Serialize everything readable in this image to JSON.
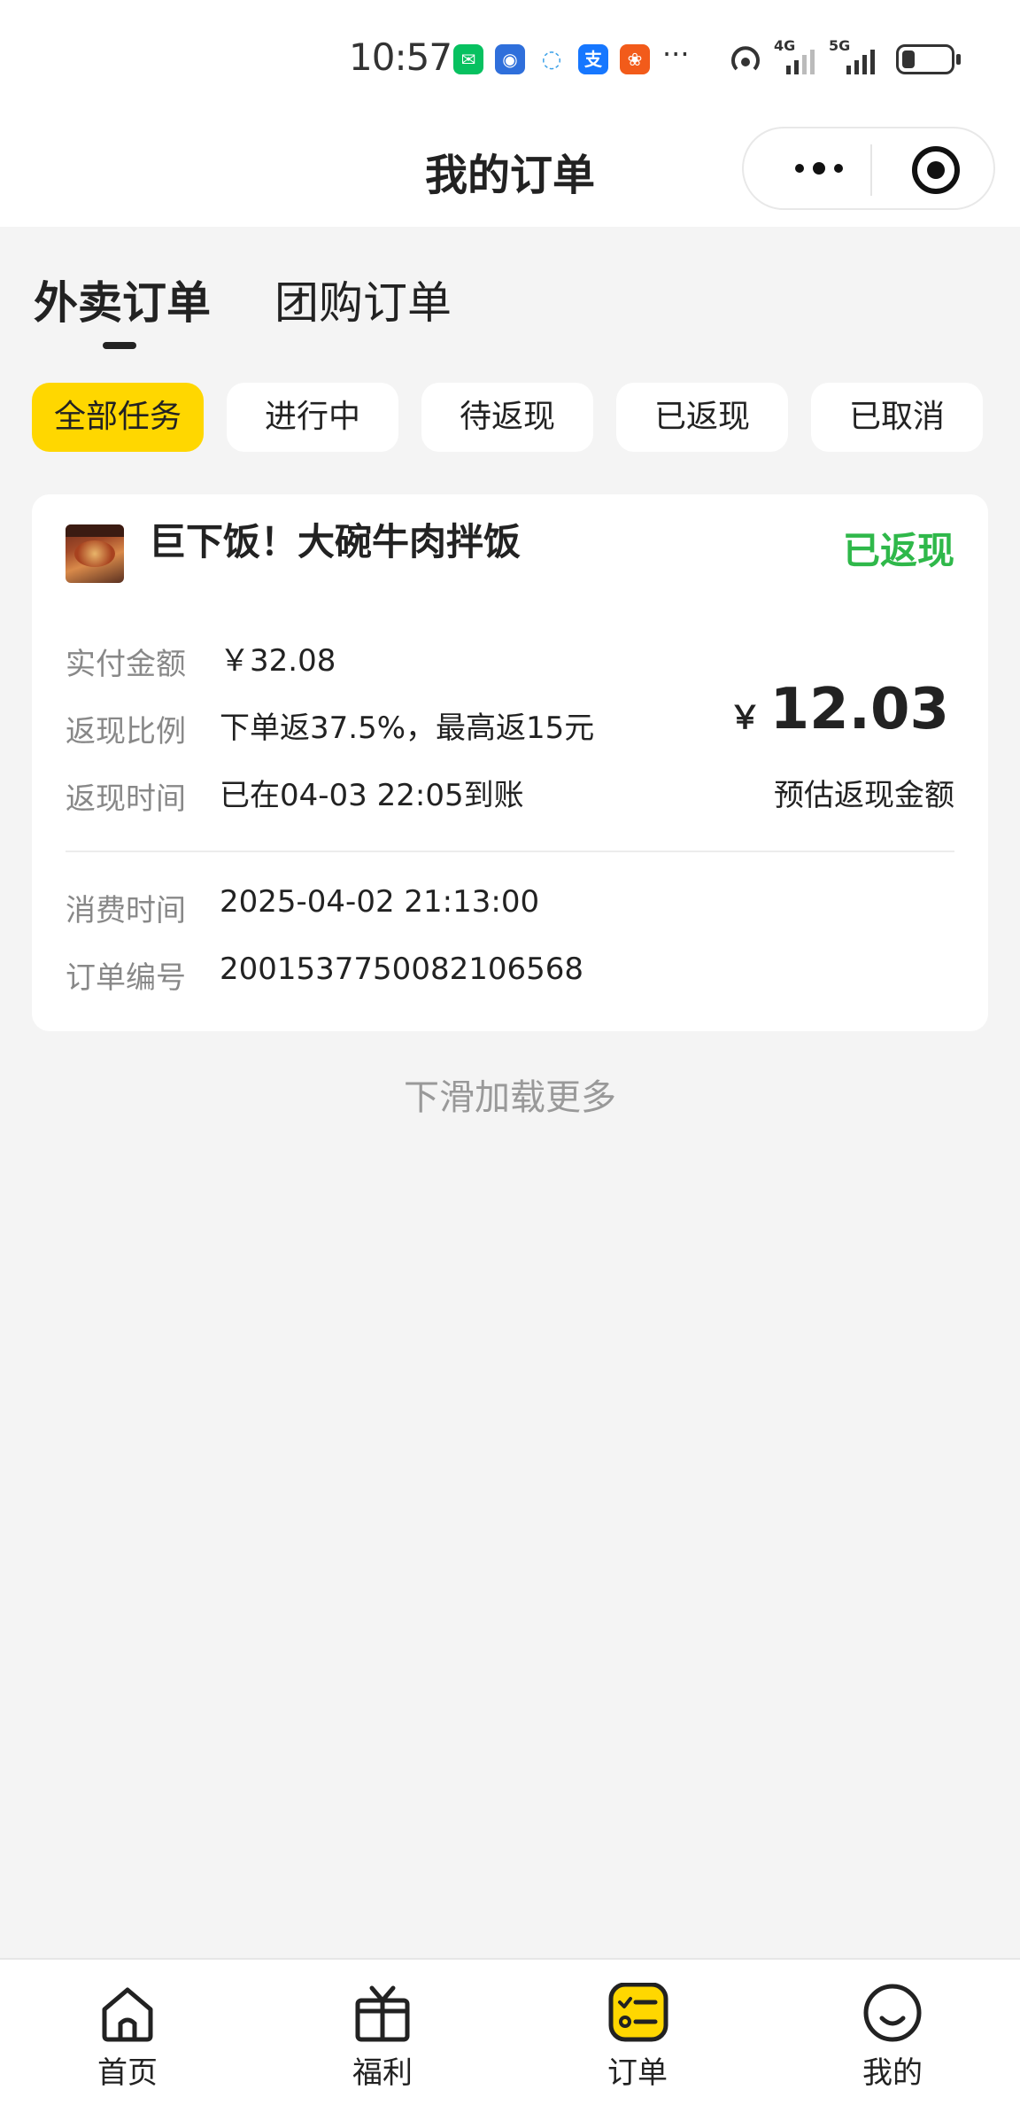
{
  "status_bar": {
    "time": "10:57",
    "apps": [
      {
        "icon": "wechat-icon",
        "color": "#07c160"
      },
      {
        "icon": "blue-app-icon",
        "color": "#2f6fdb"
      },
      {
        "icon": "chat-bubble-icon",
        "color": "#3aa0e8"
      },
      {
        "icon": "alipay-icon",
        "color": "#1677ff"
      },
      {
        "icon": "orange-app-icon",
        "color": "#f25b1a"
      }
    ],
    "more": "···",
    "network_4g": "4G",
    "network_5g": "5G"
  },
  "navbar": {
    "title": "我的订单"
  },
  "main_tabs": [
    {
      "label": "外卖订单",
      "active": true
    },
    {
      "label": "团购订单",
      "active": false
    }
  ],
  "filters": [
    {
      "label": "全部任务",
      "active": true
    },
    {
      "label": "进行中",
      "active": false
    },
    {
      "label": "待返现",
      "active": false
    },
    {
      "label": "已返现",
      "active": false
    },
    {
      "label": "已取消",
      "active": false
    }
  ],
  "order": {
    "shop_name": "巨下饭！大碗牛肉拌饭",
    "status": "已返现",
    "status_color": "#2fb84a",
    "paid_label": "实付金额",
    "paid_value": "￥32.08",
    "ratio_label": "返现比例",
    "ratio_value": "下单返37.5%，最高返15元",
    "time_label": "返现时间",
    "time_value": "已在04-03 22:05到账",
    "cashback_currency": "￥",
    "cashback_amount": "12.03",
    "cashback_caption": "预估返现金额",
    "consume_label": "消费时间",
    "consume_value": "2025-04-02 21:13:00",
    "order_no_label": "订单编号",
    "order_no_value": "2001537750082106568"
  },
  "load_more": "下滑加载更多",
  "tabbar": [
    {
      "label": "首页",
      "icon": "home-icon"
    },
    {
      "label": "福利",
      "icon": "gift-icon"
    },
    {
      "label": "订单",
      "icon": "order-list-icon",
      "active": true,
      "color": "#ffd700"
    },
    {
      "label": "我的",
      "icon": "smile-face-icon"
    }
  ]
}
